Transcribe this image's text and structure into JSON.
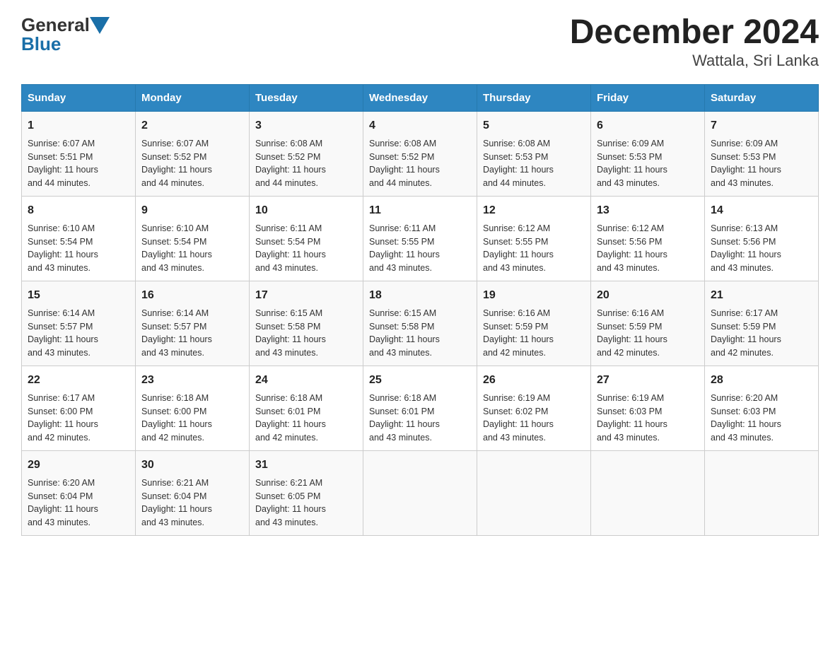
{
  "logo": {
    "general": "General",
    "blue": "Blue"
  },
  "title": "December 2024",
  "subtitle": "Wattala, Sri Lanka",
  "weekdays": [
    "Sunday",
    "Monday",
    "Tuesday",
    "Wednesday",
    "Thursday",
    "Friday",
    "Saturday"
  ],
  "weeks": [
    [
      {
        "day": "1",
        "info": "Sunrise: 6:07 AM\nSunset: 5:51 PM\nDaylight: 11 hours\nand 44 minutes."
      },
      {
        "day": "2",
        "info": "Sunrise: 6:07 AM\nSunset: 5:52 PM\nDaylight: 11 hours\nand 44 minutes."
      },
      {
        "day": "3",
        "info": "Sunrise: 6:08 AM\nSunset: 5:52 PM\nDaylight: 11 hours\nand 44 minutes."
      },
      {
        "day": "4",
        "info": "Sunrise: 6:08 AM\nSunset: 5:52 PM\nDaylight: 11 hours\nand 44 minutes."
      },
      {
        "day": "5",
        "info": "Sunrise: 6:08 AM\nSunset: 5:53 PM\nDaylight: 11 hours\nand 44 minutes."
      },
      {
        "day": "6",
        "info": "Sunrise: 6:09 AM\nSunset: 5:53 PM\nDaylight: 11 hours\nand 43 minutes."
      },
      {
        "day": "7",
        "info": "Sunrise: 6:09 AM\nSunset: 5:53 PM\nDaylight: 11 hours\nand 43 minutes."
      }
    ],
    [
      {
        "day": "8",
        "info": "Sunrise: 6:10 AM\nSunset: 5:54 PM\nDaylight: 11 hours\nand 43 minutes."
      },
      {
        "day": "9",
        "info": "Sunrise: 6:10 AM\nSunset: 5:54 PM\nDaylight: 11 hours\nand 43 minutes."
      },
      {
        "day": "10",
        "info": "Sunrise: 6:11 AM\nSunset: 5:54 PM\nDaylight: 11 hours\nand 43 minutes."
      },
      {
        "day": "11",
        "info": "Sunrise: 6:11 AM\nSunset: 5:55 PM\nDaylight: 11 hours\nand 43 minutes."
      },
      {
        "day": "12",
        "info": "Sunrise: 6:12 AM\nSunset: 5:55 PM\nDaylight: 11 hours\nand 43 minutes."
      },
      {
        "day": "13",
        "info": "Sunrise: 6:12 AM\nSunset: 5:56 PM\nDaylight: 11 hours\nand 43 minutes."
      },
      {
        "day": "14",
        "info": "Sunrise: 6:13 AM\nSunset: 5:56 PM\nDaylight: 11 hours\nand 43 minutes."
      }
    ],
    [
      {
        "day": "15",
        "info": "Sunrise: 6:14 AM\nSunset: 5:57 PM\nDaylight: 11 hours\nand 43 minutes."
      },
      {
        "day": "16",
        "info": "Sunrise: 6:14 AM\nSunset: 5:57 PM\nDaylight: 11 hours\nand 43 minutes."
      },
      {
        "day": "17",
        "info": "Sunrise: 6:15 AM\nSunset: 5:58 PM\nDaylight: 11 hours\nand 43 minutes."
      },
      {
        "day": "18",
        "info": "Sunrise: 6:15 AM\nSunset: 5:58 PM\nDaylight: 11 hours\nand 43 minutes."
      },
      {
        "day": "19",
        "info": "Sunrise: 6:16 AM\nSunset: 5:59 PM\nDaylight: 11 hours\nand 42 minutes."
      },
      {
        "day": "20",
        "info": "Sunrise: 6:16 AM\nSunset: 5:59 PM\nDaylight: 11 hours\nand 42 minutes."
      },
      {
        "day": "21",
        "info": "Sunrise: 6:17 AM\nSunset: 5:59 PM\nDaylight: 11 hours\nand 42 minutes."
      }
    ],
    [
      {
        "day": "22",
        "info": "Sunrise: 6:17 AM\nSunset: 6:00 PM\nDaylight: 11 hours\nand 42 minutes."
      },
      {
        "day": "23",
        "info": "Sunrise: 6:18 AM\nSunset: 6:00 PM\nDaylight: 11 hours\nand 42 minutes."
      },
      {
        "day": "24",
        "info": "Sunrise: 6:18 AM\nSunset: 6:01 PM\nDaylight: 11 hours\nand 42 minutes."
      },
      {
        "day": "25",
        "info": "Sunrise: 6:18 AM\nSunset: 6:01 PM\nDaylight: 11 hours\nand 43 minutes."
      },
      {
        "day": "26",
        "info": "Sunrise: 6:19 AM\nSunset: 6:02 PM\nDaylight: 11 hours\nand 43 minutes."
      },
      {
        "day": "27",
        "info": "Sunrise: 6:19 AM\nSunset: 6:03 PM\nDaylight: 11 hours\nand 43 minutes."
      },
      {
        "day": "28",
        "info": "Sunrise: 6:20 AM\nSunset: 6:03 PM\nDaylight: 11 hours\nand 43 minutes."
      }
    ],
    [
      {
        "day": "29",
        "info": "Sunrise: 6:20 AM\nSunset: 6:04 PM\nDaylight: 11 hours\nand 43 minutes."
      },
      {
        "day": "30",
        "info": "Sunrise: 6:21 AM\nSunset: 6:04 PM\nDaylight: 11 hours\nand 43 minutes."
      },
      {
        "day": "31",
        "info": "Sunrise: 6:21 AM\nSunset: 6:05 PM\nDaylight: 11 hours\nand 43 minutes."
      },
      {
        "day": "",
        "info": ""
      },
      {
        "day": "",
        "info": ""
      },
      {
        "day": "",
        "info": ""
      },
      {
        "day": "",
        "info": ""
      }
    ]
  ]
}
